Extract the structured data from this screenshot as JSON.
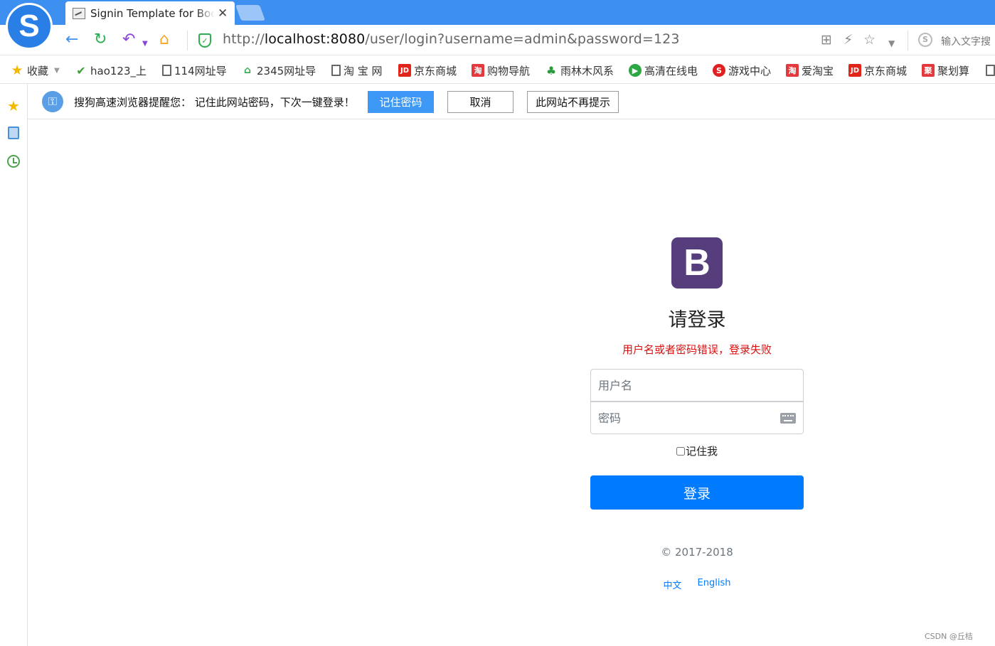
{
  "browser": {
    "tab_title": "Signin Template for Bootstrap",
    "url_scheme": "http://",
    "url_host": "localhost:8080",
    "url_path": "/user/login?username=admin&password=123",
    "search_placeholder": "输入文字搜",
    "logo_letter": "S"
  },
  "bookmarks": [
    {
      "label": "收藏",
      "icon": "star-icon"
    },
    {
      "label": "hao123_上",
      "icon": "hao123-icon"
    },
    {
      "label": "114网址导",
      "icon": "page-icon"
    },
    {
      "label": "2345网址导",
      "icon": "2345-icon"
    },
    {
      "label": "淘 宝 网",
      "icon": "page-icon"
    },
    {
      "label": "京东商城",
      "icon": "jd-icon",
      "badge": "JD"
    },
    {
      "label": "购物导航",
      "icon": "shopping-icon",
      "badge": "淘"
    },
    {
      "label": "雨林木风系",
      "icon": "sprout-icon"
    },
    {
      "label": "高清在线电",
      "icon": "video-icon"
    },
    {
      "label": "游戏中心",
      "icon": "game-icon"
    },
    {
      "label": "爱淘宝",
      "icon": "taobao-icon",
      "badge": "淘"
    },
    {
      "label": "京东商城",
      "icon": "jd-icon",
      "badge": "JD"
    },
    {
      "label": "聚划算",
      "icon": "juhuasuan-icon",
      "badge": "聚"
    }
  ],
  "password_prompt": {
    "message": "搜狗高速浏览器提醒您：  记住此网站密码，下次一键登录！",
    "save_label": "记住密码",
    "cancel_label": "取消",
    "never_label": "此网站不再提示"
  },
  "login": {
    "brand_letter": "B",
    "heading": "请登录",
    "error": "用户名或者密码错误，登录失败",
    "username_placeholder": "用户名",
    "password_placeholder": "密码",
    "remember_label": "记住我",
    "submit_label": "登录",
    "copyright": "© 2017-2018",
    "lang_zh": "中文",
    "lang_en": "English"
  },
  "watermark": "CSDN @丘桔",
  "colors": {
    "browser_accent": "#3d8ff0",
    "brand": "#563d7c",
    "primary": "#007bff",
    "error": "#dc1010"
  }
}
